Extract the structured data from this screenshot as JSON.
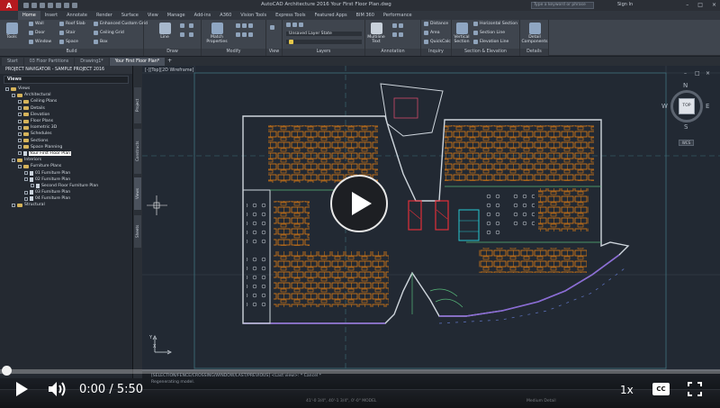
{
  "titlebar": {
    "app_title": "AutoCAD Architecture 2016   Your First Floor Plan.dwg",
    "search_placeholder": "Type a keyword or phrase",
    "sign_in": "Sign In"
  },
  "ribbon_tabs": [
    "Home",
    "Insert",
    "Annotate",
    "Render",
    "Surface",
    "View",
    "Manage",
    "Add-ins",
    "A360",
    "Vision Tools",
    "Express Tools",
    "Featured Apps",
    "BIM 360",
    "Performance"
  ],
  "ribbon": {
    "build": {
      "title": "Build",
      "tools": "Tools",
      "items": [
        "Wall",
        "Door",
        "Window",
        "Roof Slab",
        "Stair",
        "Space",
        "Enhanced Custom Grid",
        "Ceiling Grid",
        "Box"
      ]
    },
    "draw": {
      "title": "Draw",
      "line": "Line"
    },
    "modify": {
      "title": "Modify",
      "match_properties": "Match Properties"
    },
    "view": {
      "title": "View"
    },
    "layers": {
      "title": "Layers",
      "layer_state": "Unsaved Layer State"
    },
    "annotation": {
      "title": "Annotation",
      "multiline_text": "Multiline Text"
    },
    "inquiry": {
      "title": "Inquiry",
      "items": [
        "Distance",
        "Area",
        "QuickCalc"
      ]
    },
    "section": {
      "title": "Section & Elevation",
      "vertical_section": "Vertical Section",
      "items": [
        "Horizontal Section",
        "Section Line",
        "Elevation Line"
      ]
    },
    "details": {
      "title": "Details",
      "detail_components": "Detail Components"
    }
  },
  "file_tabs": [
    "Start",
    "03 Floor Partitions",
    "Drawing1*",
    "Your First Floor Plan*"
  ],
  "navigator": {
    "title": "PROJECT NAVIGATOR - SAMPLE PROJECT 2016",
    "views_label": "Views",
    "tree": [
      {
        "label": "Views",
        "level": 0,
        "kind": "folder"
      },
      {
        "label": "Architectural",
        "level": 1,
        "kind": "folder"
      },
      {
        "label": "Ceiling Plans",
        "level": 2,
        "kind": "folder"
      },
      {
        "label": "Details",
        "level": 2,
        "kind": "folder"
      },
      {
        "label": "Elevation",
        "level": 2,
        "kind": "folder"
      },
      {
        "label": "Floor Plans",
        "level": 2,
        "kind": "folder"
      },
      {
        "label": "Isometric 3D",
        "level": 2,
        "kind": "folder"
      },
      {
        "label": "Schedules",
        "level": 2,
        "kind": "folder"
      },
      {
        "label": "Sections",
        "level": 2,
        "kind": "folder"
      },
      {
        "label": "Space Planning",
        "level": 2,
        "kind": "folder"
      },
      {
        "label": "Your First Floor Plan",
        "level": 2,
        "kind": "doc",
        "selected": true
      },
      {
        "label": "Interiors",
        "level": 1,
        "kind": "folder"
      },
      {
        "label": "Furniture Plans",
        "level": 2,
        "kind": "folder"
      },
      {
        "label": "01 Furniture Plan",
        "level": 3,
        "kind": "doc"
      },
      {
        "label": "02 Furniture Plan",
        "level": 3,
        "kind": "doc"
      },
      {
        "label": "Second Floor Furniture Plan",
        "level": 4,
        "kind": "doc"
      },
      {
        "label": "03 Furniture Plan",
        "level": 3,
        "kind": "doc"
      },
      {
        "label": "04 Furniture Plan",
        "level": 3,
        "kind": "doc"
      },
      {
        "label": "Structural",
        "level": 1,
        "kind": "folder"
      }
    ],
    "side_tabs": [
      "Project",
      "Constructs",
      "Views",
      "Sheets"
    ]
  },
  "canvas": {
    "viewport_label": "[-][Top][2D Wireframe]",
    "viewcube": {
      "n": "N",
      "s": "S",
      "e": "E",
      "w": "W",
      "face": "TOP",
      "wcs": "WCS"
    },
    "ucs_x": "X",
    "ucs_y": "Y"
  },
  "command": {
    "line1": "[SELECTION/FENCE/CROSSING/WINDOW/LAST/PREVIOUS] <Last view>: * Cancel *",
    "line2": "Regenerating model.",
    "prompt": "Type a command"
  },
  "status": {
    "coords": "41'-0 3/4\", 40'-1 3/4\", 0'-0\"   MODEL",
    "detail": "Medium Detail"
  },
  "player": {
    "time_current": "0:00",
    "time_total": "5:50",
    "time_sep": "/",
    "speed": "1x",
    "cc": "CC",
    "progress": 0.0
  },
  "colors": {
    "canvas_bg": "#222933",
    "furniture": "#e07d12",
    "walls": "#cfd6dd",
    "accent_red": "#b5191f",
    "curtain_wall": "#8a6ad6"
  }
}
